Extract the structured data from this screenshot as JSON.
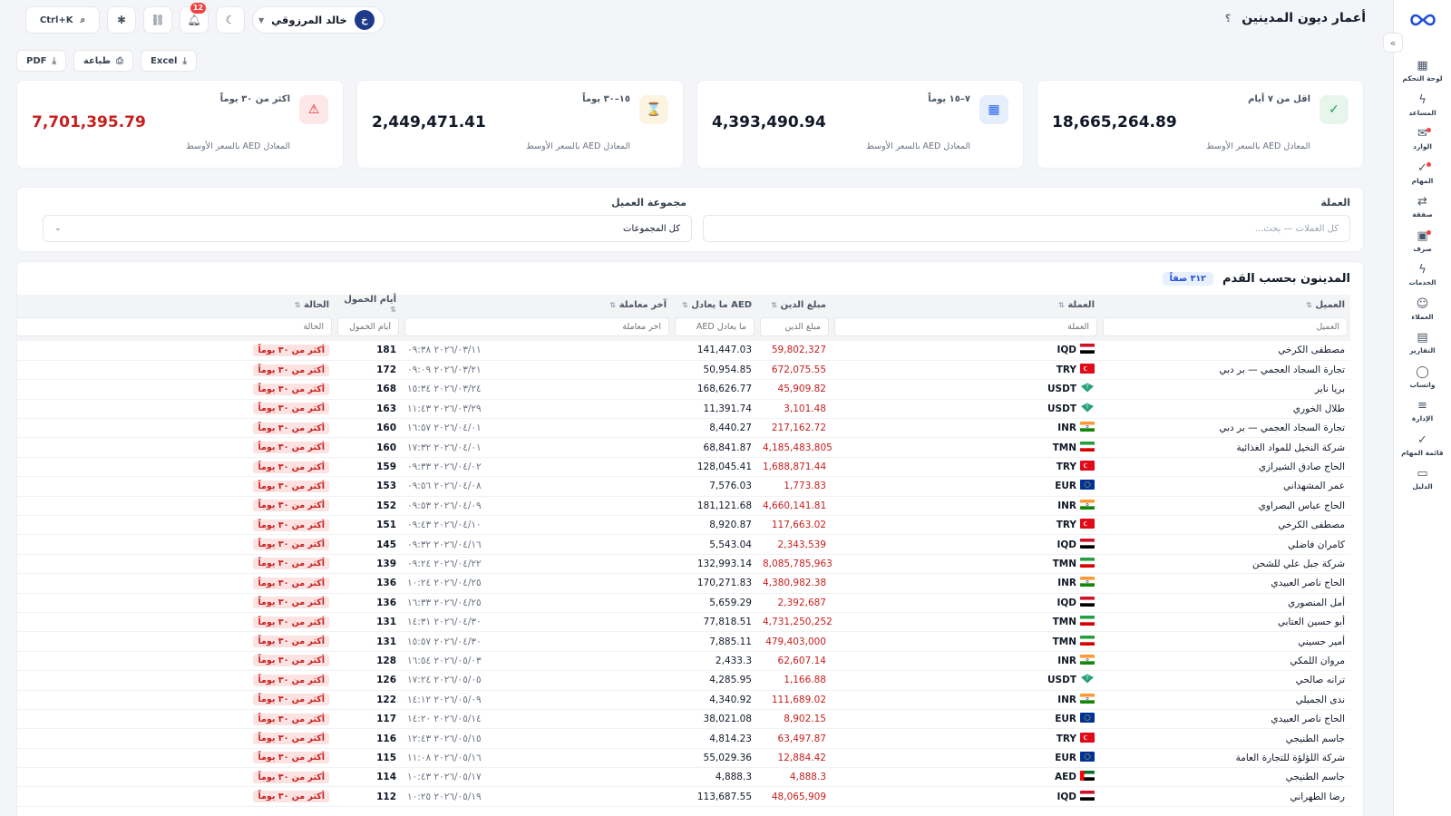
{
  "app": {
    "title": "أعمار ديون المدينين",
    "help": "؟"
  },
  "topbar": {
    "user_name": "خالد المرزوقي",
    "user_initial": "خ",
    "notifications_count": "12",
    "search_shortcut": "Ctrl+K"
  },
  "exports": {
    "pdf": "PDF",
    "print": "طباعة",
    "excel": "Excel"
  },
  "sidebar": {
    "items": [
      {
        "label": "لوحة التحكم",
        "icon": "dashboard-icon",
        "glyph": "▦"
      },
      {
        "label": "المساعد",
        "icon": "bolt-icon",
        "glyph": "ϟ"
      },
      {
        "label": "الوارد",
        "icon": "inbox-icon",
        "glyph": "✉"
      },
      {
        "label": "المهام",
        "icon": "check-icon",
        "glyph": "✓"
      },
      {
        "label": "صفقة",
        "icon": "exchange-icon",
        "glyph": "⇄"
      },
      {
        "label": "صرف",
        "icon": "cash-icon",
        "glyph": "▣"
      },
      {
        "label": "الخدمات",
        "icon": "bolt-icon",
        "glyph": "ϟ"
      },
      {
        "label": "العملاء",
        "icon": "users-icon",
        "glyph": "☺"
      },
      {
        "label": "التقارير",
        "icon": "report-icon",
        "glyph": "▤"
      },
      {
        "label": "واتساب",
        "icon": "chat-icon",
        "glyph": "◯"
      },
      {
        "label": "الإدارة",
        "icon": "sliders-icon",
        "glyph": "≡"
      },
      {
        "label": "قائمة المهام",
        "icon": "checklist-icon",
        "glyph": "✓"
      },
      {
        "label": "الدليل",
        "icon": "book-icon",
        "glyph": "▭"
      }
    ]
  },
  "cards": [
    {
      "label": "اقل من ٧ أيام",
      "value": "18,665,264.89",
      "sub": "المعادل AED بالسعر الأوسط",
      "icon": "check-circle-icon",
      "color": "#16a34a",
      "bg": "#e6f6ec"
    },
    {
      "label": "٧–١٥ يوماً",
      "value": "4,393,490.94",
      "sub": "المعادل AED بالسعر الأوسط",
      "icon": "calendar-icon",
      "color": "#2563eb",
      "bg": "#e6eefc"
    },
    {
      "label": "١٥–٣٠ يوماً",
      "value": "2,449,471.41",
      "sub": "المعادل AED بالسعر الأوسط",
      "icon": "hourglass-icon",
      "color": "#b45309",
      "bg": "#fdf3e1"
    },
    {
      "label": "اكثر من ٣٠ يوماً",
      "value": "7,701,395.79",
      "sub": "المعادل AED بالسعر الأوسط",
      "icon": "warning-icon",
      "color": "#dc2626",
      "bg": "#fde7e7"
    }
  ],
  "filters": {
    "currency_label": "العملة",
    "currency_placeholder": "كل العملات — بحث...",
    "group_label": "مجموعة العميل",
    "group_value": "كل المجموعات"
  },
  "table": {
    "title": "المدينون بحسب القدم",
    "count": "٣١٢ صفاً",
    "columns": {
      "client": "العميل",
      "currency": "العملة",
      "amount": "مبلغ الدين",
      "aed": "AED ما يعادل",
      "last": "آخر معاملة",
      "days": "أيام الخمول",
      "status": "الحالة"
    },
    "filter_placeholders": {
      "client": "العميل",
      "currency": "العملة",
      "amount": "مبلغ الدين",
      "aed": "ما يعادل AED",
      "last": "آخر معاملة",
      "days": "أيام الخمول",
      "status": "الحالة"
    },
    "rows": [
      {
        "client": "مصطفى الكرخي",
        "currency": "IQD",
        "amount": "59,802,327",
        "aed": "141,447.03",
        "last": "٢٠٢٦/٠٣/١١ ٠٩:٣٨",
        "days": "181",
        "status": "أكثر من ٣٠ يوماً"
      },
      {
        "client": "تجارة السجاد العجمي — بر دبي",
        "currency": "TRY",
        "amount": "672,075.55",
        "aed": "50,954.85",
        "last": "٢٠٢٦/٠٣/٢١ ٠٩:٠٩",
        "days": "172",
        "status": "أكثر من ٣٠ يوماً"
      },
      {
        "client": "بريا ناير",
        "currency": "USDT",
        "amount": "45,909.82",
        "aed": "168,626.77",
        "last": "٢٠٢٦/٠٣/٢٤ ١٥:٣٤",
        "days": "168",
        "status": "أكثر من ٣٠ يوماً"
      },
      {
        "client": "طلال الخوري",
        "currency": "USDT",
        "amount": "3,101.48",
        "aed": "11,391.74",
        "last": "٢٠٢٦/٠٣/٢٩ ١١:٤٣",
        "days": "163",
        "status": "أكثر من ٣٠ يوماً"
      },
      {
        "client": "تجارة السجاد العجمي — بر دبي",
        "currency": "INR",
        "amount": "217,162.72",
        "aed": "8,440.27",
        "last": "٢٠٢٦/٠٤/٠١ ١٦:٥٧",
        "days": "160",
        "status": "أكثر من ٣٠ يوماً"
      },
      {
        "client": "شركة النخيل للمواد الغذائية",
        "currency": "TMN",
        "amount": "4,185,483,805",
        "aed": "68,841.87",
        "last": "٢٠٢٦/٠٤/٠١ ١٧:٣٢",
        "days": "160",
        "status": "أكثر من ٣٠ يوماً"
      },
      {
        "client": "الحاج صادق الشيرازي",
        "currency": "TRY",
        "amount": "1,688,871.44",
        "aed": "128,045.41",
        "last": "٢٠٢٦/٠٤/٠٢ ٠٩:٣٣",
        "days": "159",
        "status": "أكثر من ٣٠ يوماً"
      },
      {
        "client": "عمر المشهداني",
        "currency": "EUR",
        "amount": "1,773.83",
        "aed": "7,576.03",
        "last": "٢٠٢٦/٠٤/٠٨ ٠٩:٥٦",
        "days": "153",
        "status": "أكثر من ٣٠ يوماً"
      },
      {
        "client": "الحاج عباس البصراوي",
        "currency": "INR",
        "amount": "4,660,141.81",
        "aed": "181,121.68",
        "last": "٢٠٢٦/٠٤/٠٩ ٠٩:٥٣",
        "days": "152",
        "status": "أكثر من ٣٠ يوماً"
      },
      {
        "client": "مصطفى الكرخي",
        "currency": "TRY",
        "amount": "117,663.02",
        "aed": "8,920.87",
        "last": "٢٠٢٦/٠٤/١٠ ٠٩:٤٣",
        "days": "151",
        "status": "أكثر من ٣٠ يوماً"
      },
      {
        "client": "كامران فاضلي",
        "currency": "IQD",
        "amount": "2,343,539",
        "aed": "5,543.04",
        "last": "٢٠٢٦/٠٤/١٦ ٠٩:٣٢",
        "days": "145",
        "status": "أكثر من ٣٠ يوماً"
      },
      {
        "client": "شركة جبل علي للشحن",
        "currency": "TMN",
        "amount": "8,085,785,963",
        "aed": "132,993.14",
        "last": "٢٠٢٦/٠٤/٢٢ ٠٩:٢٤",
        "days": "139",
        "status": "أكثر من ٣٠ يوماً"
      },
      {
        "client": "الحاج ناصر العبيدي",
        "currency": "INR",
        "amount": "4,380,982.38",
        "aed": "170,271.83",
        "last": "٢٠٢٦/٠٤/٢٥ ١٠:٢٤",
        "days": "136",
        "status": "أكثر من ٣٠ يوماً"
      },
      {
        "client": "أمل المنصوري",
        "currency": "IQD",
        "amount": "2,392,687",
        "aed": "5,659.29",
        "last": "٢٠٢٦/٠٤/٢٥ ١٦:٣٣",
        "days": "136",
        "status": "أكثر من ٣٠ يوماً"
      },
      {
        "client": "أبو حسين العتابي",
        "currency": "TMN",
        "amount": "4,731,250,252",
        "aed": "77,818.51",
        "last": "٢٠٢٦/٠٤/٣٠ ١٤:٣١",
        "days": "131",
        "status": "أكثر من ٣٠ يوماً"
      },
      {
        "client": "أمير حسيني",
        "currency": "TMN",
        "amount": "479,403,000",
        "aed": "7,885.11",
        "last": "٢٠٢٦/٠٤/٣٠ ١٥:٥٧",
        "days": "131",
        "status": "أكثر من ٣٠ يوماً"
      },
      {
        "client": "مروان اللمكي",
        "currency": "INR",
        "amount": "62,607.14",
        "aed": "2,433.3",
        "last": "٢٠٢٦/٠٥/٠٣ ١٦:٥٤",
        "days": "128",
        "status": "أكثر من ٣٠ يوماً"
      },
      {
        "client": "ترانه صالحي",
        "currency": "USDT",
        "amount": "1,166.88",
        "aed": "4,285.95",
        "last": "٢٠٢٦/٠٥/٠٥ ١٧:٢٤",
        "days": "126",
        "status": "أكثر من ٣٠ يوماً"
      },
      {
        "client": "ندى الجميلي",
        "currency": "INR",
        "amount": "111,689.02",
        "aed": "4,340.92",
        "last": "٢٠٢٦/٠٥/٠٩ ١٤:١٢",
        "days": "122",
        "status": "أكثر من ٣٠ يوماً"
      },
      {
        "client": "الحاج ناصر العبيدي",
        "currency": "EUR",
        "amount": "8,902.15",
        "aed": "38,021.08",
        "last": "٢٠٢٦/٠٥/١٤ ١٤:٢٠",
        "days": "117",
        "status": "أكثر من ٣٠ يوماً"
      },
      {
        "client": "جاسم الطنيجي",
        "currency": "TRY",
        "amount": "63,497.87",
        "aed": "4,814.23",
        "last": "٢٠٢٦/٠٥/١٥ ١٢:٤٣",
        "days": "116",
        "status": "أكثر من ٣٠ يوماً"
      },
      {
        "client": "شركة اللؤلؤة للتجارة العامة",
        "currency": "EUR",
        "amount": "12,884.42",
        "aed": "55,029.36",
        "last": "٢٠٢٦/٠٥/١٦ ١١:٠٨",
        "days": "115",
        "status": "أكثر من ٣٠ يوماً"
      },
      {
        "client": "جاسم الطنيجي",
        "currency": "AED",
        "amount": "4,888.3",
        "aed": "4,888.3",
        "last": "٢٠٢٦/٠٥/١٧ ١٠:٤٣",
        "days": "114",
        "status": "أكثر من ٣٠ يوماً"
      },
      {
        "client": "رضا الطهراني",
        "currency": "IQD",
        "amount": "48,065,909",
        "aed": "113,687.55",
        "last": "٢٠٢٦/٠٥/١٩ ١٠:٢٥",
        "days": "112",
        "status": "أكثر من ٣٠ يوماً"
      }
    ]
  }
}
